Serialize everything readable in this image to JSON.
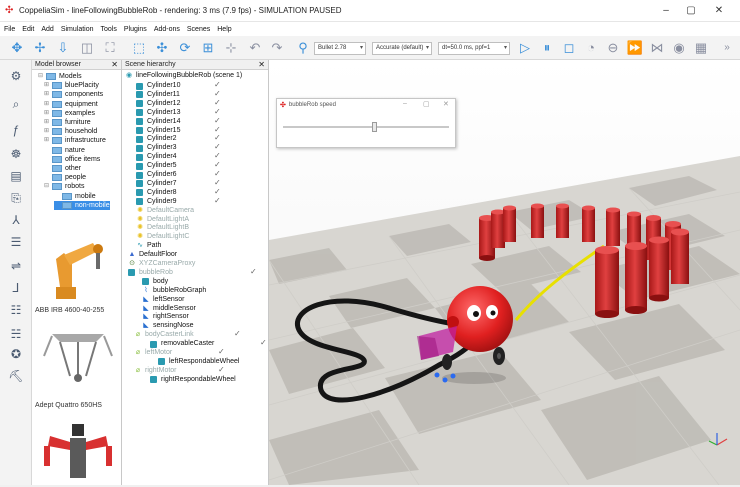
{
  "window": {
    "title": "CoppeliaSim - lineFollowingBubbleRob - rendering: 3 ms (7.9 fps) - SIMULATION PAUSED",
    "minimize": "–",
    "maximize": "▢",
    "close": "✕"
  },
  "menu": [
    "File",
    "Edit",
    "Add",
    "Simulation",
    "Tools",
    "Plugins",
    "Add-ons",
    "Scenes",
    "Help"
  ],
  "toolbar": {
    "engine": "Bullet 2.78",
    "accuracy": "Accurate (default)",
    "timestep": "dt=50.0 ms, ppf=1",
    "more": "»"
  },
  "model_browser": {
    "title": "Model browser",
    "close": "✕",
    "folders": [
      {
        "label": "Models",
        "expander": "⊟"
      },
      {
        "label": "bluePlacity",
        "expander": "⊞"
      },
      {
        "label": "components",
        "expander": "⊞"
      },
      {
        "label": "equipment",
        "expander": "⊞"
      },
      {
        "label": "examples",
        "expander": "⊞"
      },
      {
        "label": "furniture",
        "expander": "⊞"
      },
      {
        "label": "household",
        "expander": "⊞"
      },
      {
        "label": "infrastructure",
        "expander": "⊞"
      },
      {
        "label": "nature",
        "expander": ""
      },
      {
        "label": "office items",
        "expander": ""
      },
      {
        "label": "other",
        "expander": ""
      },
      {
        "label": "people",
        "expander": ""
      },
      {
        "label": "robots",
        "expander": "⊟"
      },
      {
        "label": "mobile",
        "expander": ""
      },
      {
        "label": "non-mobile",
        "expander": ""
      }
    ],
    "previews": [
      "ABB IRB 4600-40-255",
      "Adept Quattro 650HS"
    ]
  },
  "scene_hierarchy": {
    "title": "Scene hierarchy",
    "close": "✕",
    "root": "lineFollowingBubbleRob (scene 1)",
    "cylinders": [
      "Cylinder10",
      "Cylinder11",
      "Cylinder12",
      "Cylinder13",
      "Cylinder14",
      "Cylinder15",
      "Cylinder2",
      "Cylinder3",
      "Cylinder4",
      "Cylinder5",
      "Cylinder6",
      "Cylinder7",
      "Cylinder8",
      "Cylinder9"
    ],
    "lights": [
      "DefaultCamera",
      "DefaultLightA",
      "DefaultLightB",
      "DefaultLightC"
    ],
    "path": "Path",
    "floor": "DefaultFloor",
    "camera": "XYZCameraProxy",
    "robot": "bubbleRob",
    "robot_children": [
      "body",
      "bubbleRobGraph",
      "leftSensor",
      "middleSensor",
      "rightSensor",
      "sensingNose"
    ],
    "caster_link": "bodyCasterLink",
    "caster": "removableCaster",
    "left_motor": "leftMotor",
    "left_wheel": "leftRespondableWheel",
    "right_motor": "rightMotor",
    "right_wheel": "rightRespondableWheel"
  },
  "speed_window": {
    "title": "bubbleRob speed",
    "slider_fraction": 0.55
  },
  "colors": {
    "robot": "#e02020",
    "cylinder": "#d42a2a",
    "path": "#e8e000",
    "line": "#151515",
    "floor_light": "#d9d7d2",
    "floor_dark": "#bdbab4",
    "sky": "#ffffff"
  }
}
